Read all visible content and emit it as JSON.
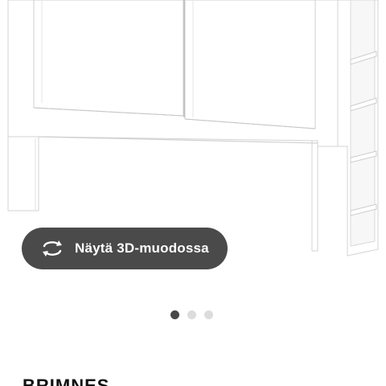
{
  "carousel": {
    "view_3d_label": "Näytä 3D-muodossa",
    "view_3d_icon": "rotate-3d-icon",
    "slide_count": 3,
    "active_slide": 1
  },
  "product": {
    "name": "BRIMNES"
  },
  "colors": {
    "button_bg": "#4a4a4a",
    "active_dot": "#484848",
    "inactive_dot": "#dcdcdc"
  }
}
